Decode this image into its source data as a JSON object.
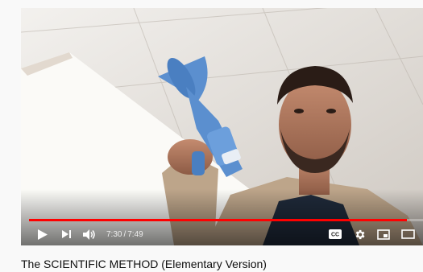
{
  "player": {
    "current_time": "7:30",
    "duration": "7:49",
    "progress_fraction": 0.96,
    "cc_label": "CC",
    "accent_color": "#ff0000"
  },
  "video": {
    "title": "The SCIENTIFIC METHOD (Elementary Version)"
  },
  "icons": [
    "play-icon",
    "next-icon",
    "volume-icon",
    "cc-icon",
    "settings-gear-icon",
    "miniplayer-icon",
    "theater-mode-icon"
  ]
}
